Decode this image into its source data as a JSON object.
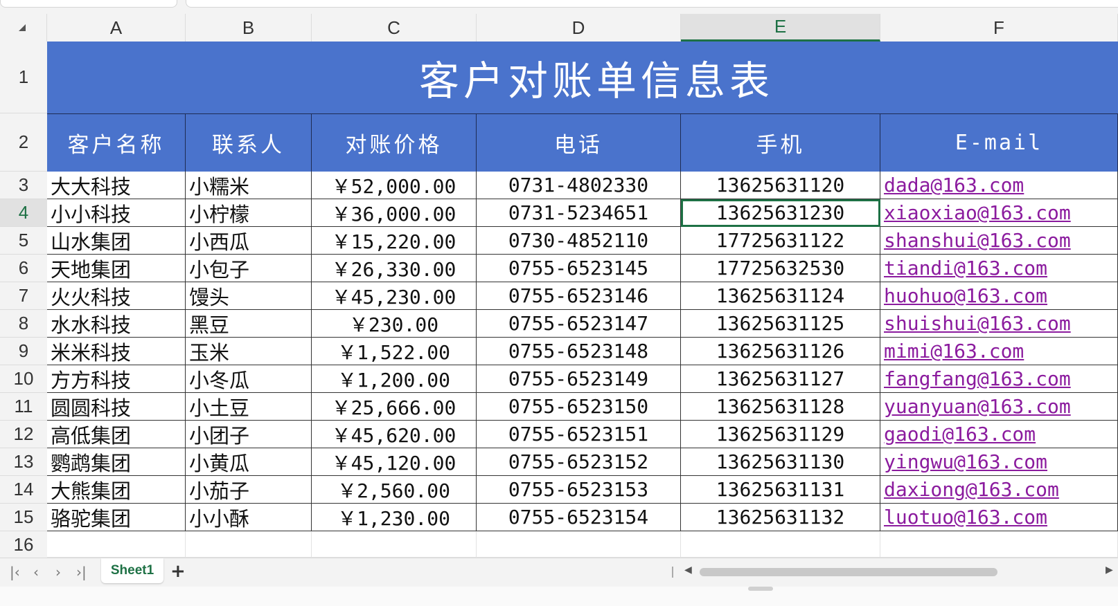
{
  "columns": [
    "A",
    "B",
    "C",
    "D",
    "E",
    "F"
  ],
  "selected_column": "E",
  "selected_row": "4",
  "rows": [
    "1",
    "2",
    "3",
    "4",
    "5",
    "6",
    "7",
    "8",
    "9",
    "10",
    "11",
    "12",
    "13",
    "14",
    "15",
    "16"
  ],
  "title": "客户对账单信息表",
  "headers": [
    "客户名称",
    "联系人",
    "对账价格",
    "电话",
    "手机",
    "E-mail"
  ],
  "records": [
    [
      "大大科技",
      "小糯米",
      "￥52,000.00",
      "0731-4802330",
      "13625631120",
      "dada@163.com"
    ],
    [
      "小小科技",
      "小柠檬",
      "￥36,000.00",
      "0731-5234651",
      "13625631230",
      "xiaoxiao@163.com"
    ],
    [
      "山水集团",
      "小西瓜",
      "￥15,220.00",
      "0730-4852110",
      "17725631122",
      "shanshui@163.com"
    ],
    [
      "天地集团",
      "小包子",
      "￥26,330.00",
      "0755-6523145",
      "17725632530",
      "tiandi@163.com"
    ],
    [
      "火火科技",
      "馒头",
      "￥45,230.00",
      "0755-6523146",
      "13625631124",
      "huohuo@163.com"
    ],
    [
      "水水科技",
      "黑豆",
      "￥230.00",
      "0755-6523147",
      "13625631125",
      "shuishui@163.com"
    ],
    [
      "米米科技",
      "玉米",
      "￥1,522.00",
      "0755-6523148",
      "13625631126",
      "mimi@163.com"
    ],
    [
      "方方科技",
      "小冬瓜",
      "￥1,200.00",
      "0755-6523149",
      "13625631127",
      "fangfang@163.com"
    ],
    [
      "圆圆科技",
      "小土豆",
      "￥25,666.00",
      "0755-6523150",
      "13625631128",
      "yuanyuan@163.com"
    ],
    [
      "高低集团",
      "小团子",
      "￥45,620.00",
      "0755-6523151",
      "13625631129",
      "gaodi@163.com"
    ],
    [
      "鹦鹉集团",
      "小黄瓜",
      "￥45,120.00",
      "0755-6523152",
      "13625631130",
      "yingwu@163.com"
    ],
    [
      "大熊集团",
      "小茄子",
      "￥2,560.00",
      "0755-6523153",
      "13625631131",
      "daxiong@163.com"
    ],
    [
      "骆驼集团",
      "小小酥",
      "￥1,230.00",
      "0755-6523154",
      "13625631132",
      "luotuo@163.com"
    ]
  ],
  "sheet_tab": "Sheet1",
  "add_sheet": "+",
  "icons": {
    "select_all": "select-all-triangle-icon",
    "first_sheet": "first-sheet-icon",
    "prev_sheet": "prev-sheet-icon",
    "next_sheet": "next-sheet-icon",
    "last_sheet": "last-sheet-icon",
    "scroll_left": "scroll-left-icon",
    "scroll_right": "scroll-right-icon"
  },
  "colors": {
    "header_fill": "#4a73cc",
    "active_green": "#1e7145",
    "link_purple": "#8b1b9e"
  }
}
